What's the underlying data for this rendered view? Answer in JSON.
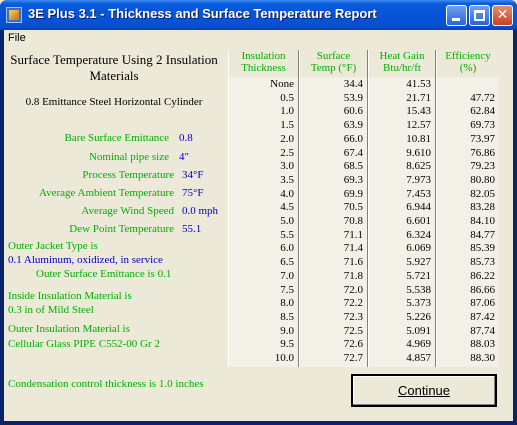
{
  "window": {
    "title": "3E Plus 3.1 - Thickness and Surface Temperature Report"
  },
  "menu": {
    "file": "File"
  },
  "report": {
    "heading": "Surface Temperature Using 2 Insulation Materials",
    "subheading": "0.8 Emittance Steel Horizontal Cylinder"
  },
  "params": [
    {
      "label": "Bare Surface Emittance",
      "value": "0.8"
    },
    {
      "label": "Nominal pipe size",
      "value": "4\""
    },
    {
      "label": "Process Temperature",
      "value": "34°F"
    },
    {
      "label": "Average Ambient Temperature",
      "value": "75°F"
    },
    {
      "label": "Average Wind Speed",
      "value": "0.0 mph"
    },
    {
      "label": "Dew Point Temperature",
      "value": "55.1"
    }
  ],
  "jacket": {
    "label": "Outer Jacket Type is",
    "value": "0.1  Aluminum, oxidized, in service",
    "emittance": "Outer Surface Emittance is 0.1"
  },
  "inside_material": {
    "label": "Inside Insulation Material is",
    "value": "0.3 in of Mild Steel"
  },
  "outer_material": {
    "label": "Outer Insulation Material is",
    "value": "Cellular Glass PIPE C552-00 Gr 2"
  },
  "table": {
    "headers": {
      "thickness": [
        "Insulation",
        "Thickness"
      ],
      "surface": [
        "Surface",
        "Temp (°F)"
      ],
      "heat": [
        "Heat Gain",
        "Btu/hr/ft"
      ],
      "efficiency": [
        "Efficiency",
        "(%)"
      ]
    },
    "rows": [
      {
        "thickness": "None",
        "surface": "34.4",
        "heat": "41.53",
        "efficiency": ""
      },
      {
        "thickness": "0.5",
        "surface": "53.9",
        "heat": "21.71",
        "efficiency": "47.72"
      },
      {
        "thickness": "1.0",
        "surface": "60.6",
        "heat": "15.43",
        "efficiency": "62.84"
      },
      {
        "thickness": "1.5",
        "surface": "63.9",
        "heat": "12.57",
        "efficiency": "69.73"
      },
      {
        "thickness": "2.0",
        "surface": "66.0",
        "heat": "10.81",
        "efficiency": "73.97"
      },
      {
        "thickness": "2.5",
        "surface": "67.4",
        "heat": "9.610",
        "efficiency": "76.86"
      },
      {
        "thickness": "3.0",
        "surface": "68.5",
        "heat": "8.625",
        "efficiency": "79.23"
      },
      {
        "thickness": "3.5",
        "surface": "69.3",
        "heat": "7.973",
        "efficiency": "80.80"
      },
      {
        "thickness": "4.0",
        "surface": "69.9",
        "heat": "7.453",
        "efficiency": "82.05"
      },
      {
        "thickness": "4.5",
        "surface": "70.5",
        "heat": "6.944",
        "efficiency": "83.28"
      },
      {
        "thickness": "5.0",
        "surface": "70.8",
        "heat": "6.601",
        "efficiency": "84.10"
      },
      {
        "thickness": "5.5",
        "surface": "71.1",
        "heat": "6.324",
        "efficiency": "84.77"
      },
      {
        "thickness": "6.0",
        "surface": "71.4",
        "heat": "6.069",
        "efficiency": "85.39"
      },
      {
        "thickness": "6.5",
        "surface": "71.6",
        "heat": "5.927",
        "efficiency": "85.73"
      },
      {
        "thickness": "7.0",
        "surface": "71.8",
        "heat": "5.721",
        "efficiency": "86.22"
      },
      {
        "thickness": "7.5",
        "surface": "72.0",
        "heat": "5.538",
        "efficiency": "86.66"
      },
      {
        "thickness": "8.0",
        "surface": "72.2",
        "heat": "5.373",
        "efficiency": "87.06"
      },
      {
        "thickness": "8.5",
        "surface": "72.3",
        "heat": "5.226",
        "efficiency": "87.42"
      },
      {
        "thickness": "9.0",
        "surface": "72.5",
        "heat": "5.091",
        "efficiency": "87.74"
      },
      {
        "thickness": "9.5",
        "surface": "72.6",
        "heat": "4.969",
        "efficiency": "88.03"
      },
      {
        "thickness": "10.0",
        "surface": "72.7",
        "heat": "4.857",
        "efficiency": "88.30"
      }
    ]
  },
  "condensation": "Condensation control thickness is 1.0 inches",
  "continue_label": "Continue",
  "colors": {
    "label_green": "#00B000",
    "value_blue": "#0000CC",
    "titlebar": "#0653D8",
    "background": "#ECE9D8"
  }
}
